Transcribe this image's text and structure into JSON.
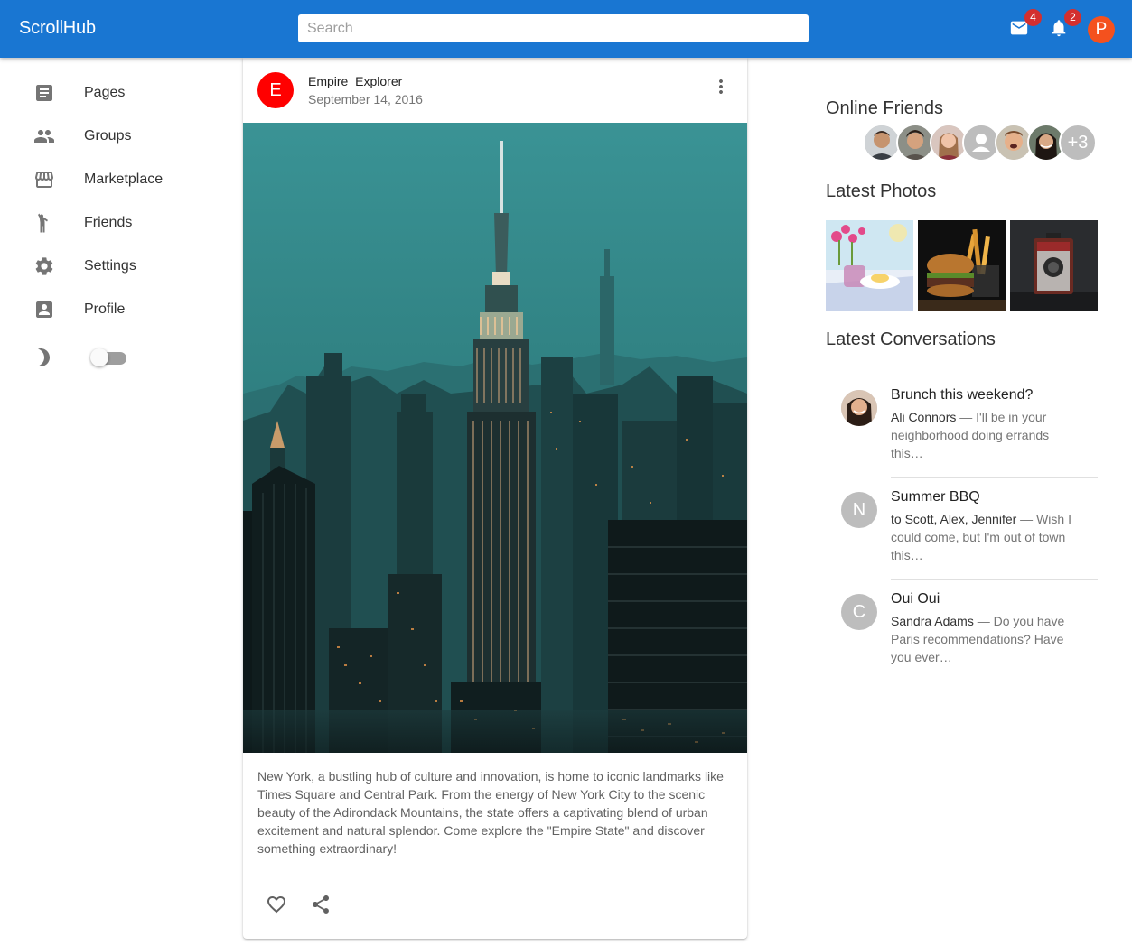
{
  "app": {
    "title": "ScrollHub"
  },
  "search": {
    "placeholder": "Search"
  },
  "header": {
    "mail_count": "4",
    "notif_count": "2",
    "user_initial": "P"
  },
  "sidebar": {
    "items": [
      {
        "label": "Pages",
        "icon": "article-icon"
      },
      {
        "label": "Groups",
        "icon": "group-icon"
      },
      {
        "label": "Marketplace",
        "icon": "storefront-icon"
      },
      {
        "label": "Friends",
        "icon": "person-wave-icon"
      },
      {
        "label": "Settings",
        "icon": "gear-icon"
      },
      {
        "label": "Profile",
        "icon": "account-box-icon"
      }
    ],
    "dark_mode": false
  },
  "post": {
    "author_initial": "E",
    "author": "Empire_Explorer",
    "date": "September 14, 2016",
    "text": "New York, a bustling hub of culture and innovation, is home to iconic landmarks like Times Square and Central Park. From the energy of New York City to the scenic beauty of the Adirondack Mountains, the state offers a captivating blend of urban excitement and natural splendor. Come explore the \"Empire State\" and discover something extraordinary!",
    "avatar_color": "#ff0000"
  },
  "right": {
    "online_title": "Online Friends",
    "more_friends": "+3",
    "photos_title": "Latest Photos",
    "conversations_title": "Latest Conversations",
    "conversations": [
      {
        "subject": "Brunch this weekend?",
        "who": "Ali Connors",
        "preview": " — I'll be in your neighborhood doing errands this…",
        "avatar": ""
      },
      {
        "subject": "Summer BBQ",
        "who": "to Scott, Alex, Jennifer",
        "preview": " — Wish I could come, but I'm out of town this…",
        "avatar": "N"
      },
      {
        "subject": "Oui Oui",
        "who": "Sandra Adams",
        "preview": " — Do you have Paris recommendations? Have you ever…",
        "avatar": "C"
      }
    ]
  },
  "colors": {
    "appbar": "#1976d2",
    "badge": "#d32f2f",
    "user_avatar": "#f4511e"
  }
}
